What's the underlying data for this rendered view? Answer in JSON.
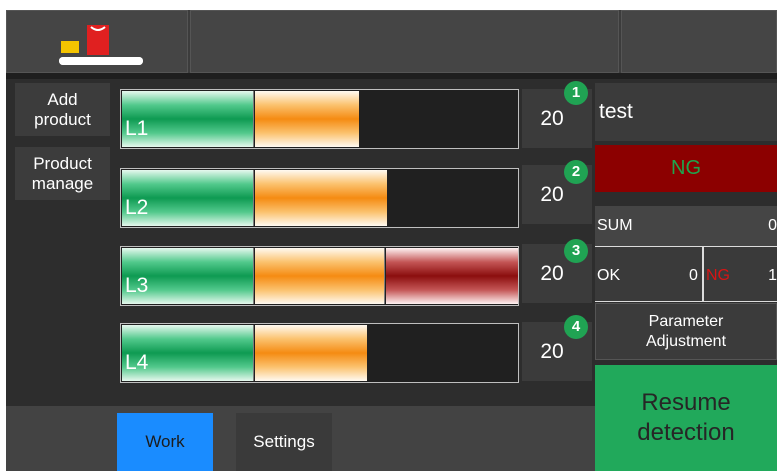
{
  "menu": {
    "add_product": "Add\nproduct",
    "product_manage": "Product\nmanage"
  },
  "lanes": [
    {
      "label": "L1",
      "count": "20",
      "badge": "1"
    },
    {
      "label": "L2",
      "count": "20",
      "badge": "2"
    },
    {
      "label": "L3",
      "count": "20",
      "badge": "3"
    },
    {
      "label": "L4",
      "count": "20",
      "badge": "4"
    }
  ],
  "panel": {
    "product_name": "test",
    "status": "NG",
    "sum_label": "SUM",
    "sum_value": "0",
    "ok_label": "OK",
    "ok_value": "0",
    "ng_label": "NG",
    "ng_value": "1",
    "param_button": "Parameter\nAdjustment",
    "resume_button": "Resume\ndetection"
  },
  "tabs": {
    "work": "Work",
    "settings": "Settings"
  },
  "colors": {
    "accent_blue": "#1a8cff",
    "resume_green": "#21a95b",
    "status_red": "#8c0000",
    "badge_green": "#20a353"
  },
  "icons": {
    "logo": "conveyor-product-icon"
  }
}
